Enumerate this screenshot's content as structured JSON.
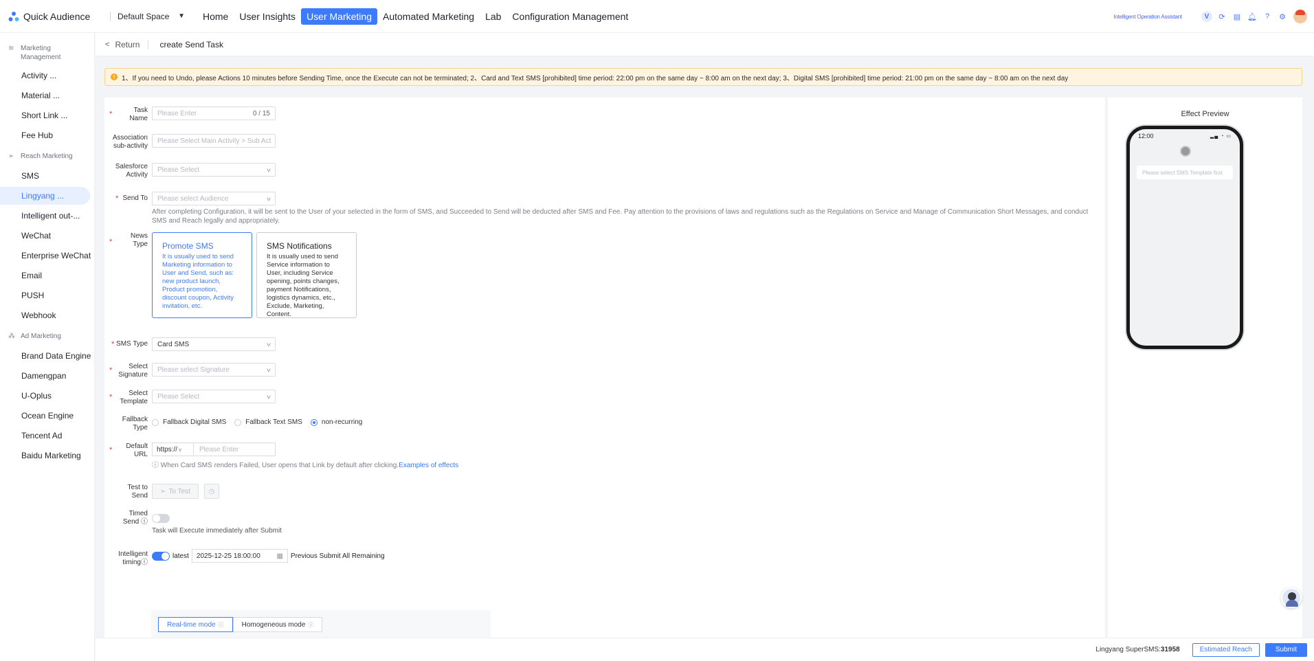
{
  "app": {
    "name": "Quick Audience",
    "space": "Default Space"
  },
  "nav": [
    "Home",
    "User Insights",
    "User Marketing",
    "Automated Marketing",
    "Lab",
    "Configuration Management"
  ],
  "nav_active": "User Marketing",
  "top_right": {
    "assistant": "Intelligent Operation Assistant",
    "v": "V"
  },
  "sidebar": {
    "sections": [
      {
        "title": "Marketing Management",
        "items": [
          "Activity ...",
          "Material ...",
          "Short Link ...",
          "Fee Hub"
        ]
      },
      {
        "title": "Reach Marketing",
        "items": [
          "SMS",
          "Lingyang ...",
          "Intelligent out-...",
          "WeChat",
          "Enterprise WeChat",
          "Email",
          "PUSH",
          "Webhook"
        ]
      },
      {
        "title": "Ad Marketing",
        "items": [
          "Brand Data Engine",
          "Damengpan",
          "U-Oplus",
          "Ocean Engine",
          "Tencent Ad",
          "Baidu Marketing"
        ]
      }
    ],
    "active": "Lingyang ..."
  },
  "header": {
    "back": "Return",
    "title": "create Send Task"
  },
  "alert": "1、If you need to Undo, please Actions 10 minutes before Sending Time, once the Execute can not be terminated; 2、Card and Text SMS [prohibited] time period: 22:00 pm on the same day ~ 8:00 am on the next day; 3、Digital SMS [prohibited] time period: 21:00 pm on the same day ~ 8:00 am on the next day",
  "form": {
    "task_name": {
      "label": "Task Name",
      "placeholder": "Please Enter",
      "count": "0 / 15"
    },
    "association": {
      "label": "Association sub-activity",
      "placeholder": "Please Select Main Activity > Sub Act"
    },
    "salesforce": {
      "label": "Salesforce Activity",
      "placeholder": "Please Select"
    },
    "send_to": {
      "label": "Send To",
      "placeholder": "Please select Audience",
      "hint": "After completing Configuration, it will be sent to the User of your selected in the form of SMS, and Succeeded to Send will be deducted after SMS and Fee. Pay attention to the provisions of laws and regulations such as the Regulations on Service and Manage of Communication Short Messages, and conduct SMS and Reach legally and appropriately."
    },
    "news_type": {
      "label": "News Type",
      "cards": [
        {
          "title": "Promote SMS",
          "desc": "It is usually used to send Marketing information to User and Send, such as: new product launch, Product promotion, discount coupon, Activity invitation, etc.",
          "selected": true
        },
        {
          "title": "SMS Notifications",
          "desc": "It is usually used to send Service information to User, including Service opening, points changes, payment Notifications, logistics dynamics, etc., Exclude, Marketing, Content.",
          "selected": false
        }
      ]
    },
    "sms_type": {
      "label": "SMS Type",
      "value": "Card SMS"
    },
    "signature": {
      "label": "Select Signature",
      "placeholder": "Please select Signature"
    },
    "template": {
      "label": "Select Template",
      "placeholder": "Please Select"
    },
    "fallback": {
      "label": "Fallback Type",
      "options": [
        "Fallback Digital SMS",
        "Fallback Text SMS",
        "non-recurring"
      ],
      "selected": "non-recurring"
    },
    "default_url": {
      "label": "Default URL",
      "protocol": "https://",
      "placeholder": "Please Enter",
      "note": "When Card SMS renders Failed, User opens that Link by default after clicking.",
      "link": "Examples of effects"
    },
    "test": {
      "label": "Test to Send",
      "button": "To Test"
    },
    "timed": {
      "label": "Timed Send",
      "note": "Task will Execute immediately after Submit",
      "on": false
    },
    "intelligent": {
      "label": "Intelligent timing",
      "latest": "latest",
      "datetime": "2025-12-25 18:00:00",
      "remaining": "Previous Submit All Remaining",
      "on": true
    },
    "modes": [
      "Real-time mode",
      "Homogeneous mode"
    ],
    "mode_active": "Real-time mode"
  },
  "preview": {
    "title": "Effect Preview",
    "time": "12:00",
    "message": "Please select SMS Template first"
  },
  "footer": {
    "quota_label": "Lingyang SuperSMS:",
    "quota_value": "31958",
    "estimated": "Estimated Reach",
    "submit": "Submit"
  },
  "colors": {
    "primary": "#3c7bfa",
    "alert_bg": "#fef4e0",
    "required": "#e53935"
  }
}
